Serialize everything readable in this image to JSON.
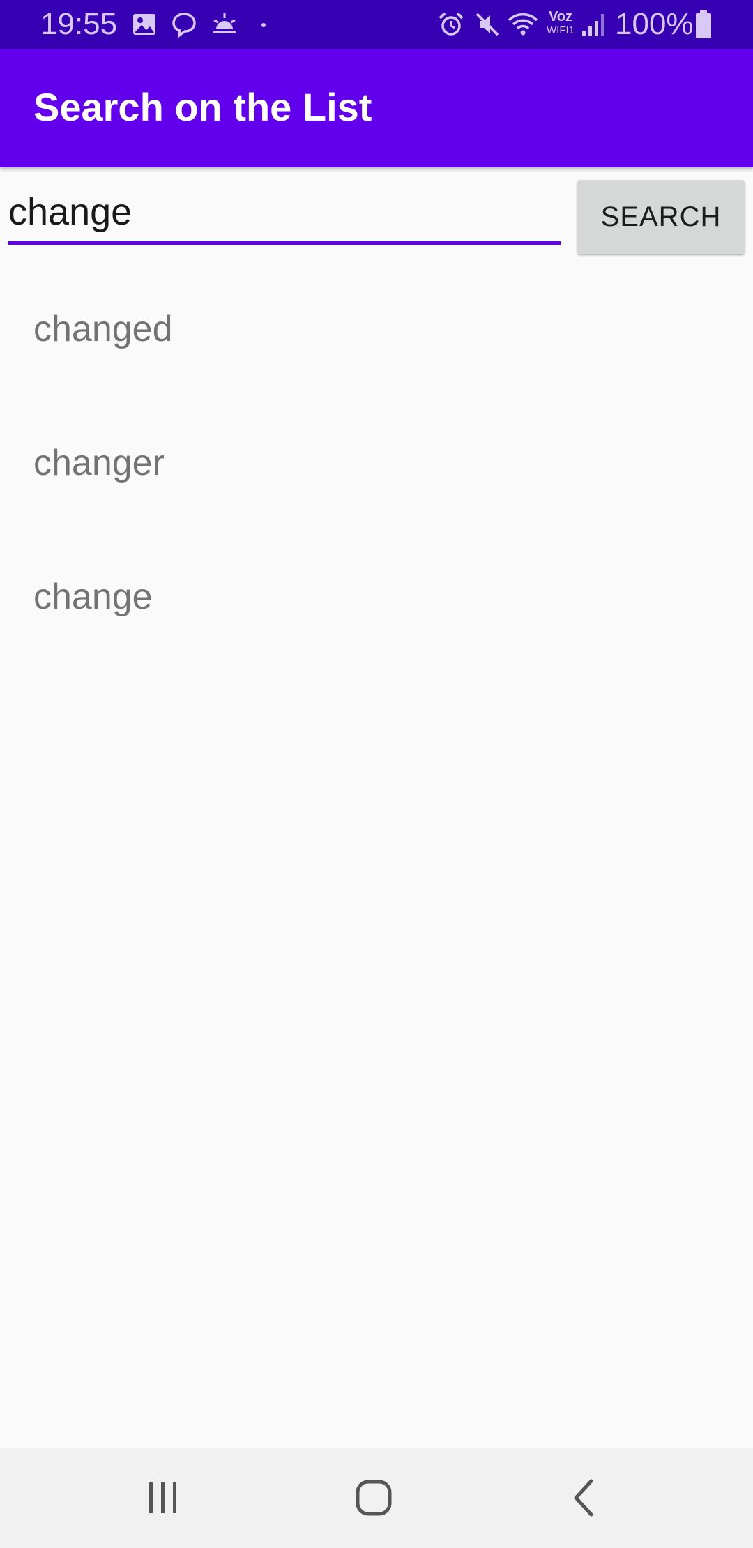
{
  "status_bar": {
    "time": "19:55",
    "battery_percent": "100%",
    "wifi_label_top": "Voz",
    "wifi_label_bottom": "WIFI1",
    "icons": [
      "gallery-icon",
      "chat-bubble-icon",
      "sunrise-weather-icon",
      "alarm-icon",
      "mute-icon",
      "wifi-icon",
      "signal-icon",
      "battery-icon"
    ]
  },
  "app_bar": {
    "title": "Search on the List"
  },
  "search": {
    "value": "change",
    "button_label": "SEARCH"
  },
  "results": [
    {
      "label": "changed"
    },
    {
      "label": "changer"
    },
    {
      "label": "change"
    }
  ],
  "nav_bar": {
    "icons": [
      "recent-apps-icon",
      "home-icon",
      "back-icon"
    ]
  },
  "colors": {
    "status_bar": "#3700b3",
    "app_bar": "#6200ee",
    "accent": "#6200ee",
    "background": "#fafafa",
    "button": "#d6d7d7",
    "list_text": "#737373"
  }
}
